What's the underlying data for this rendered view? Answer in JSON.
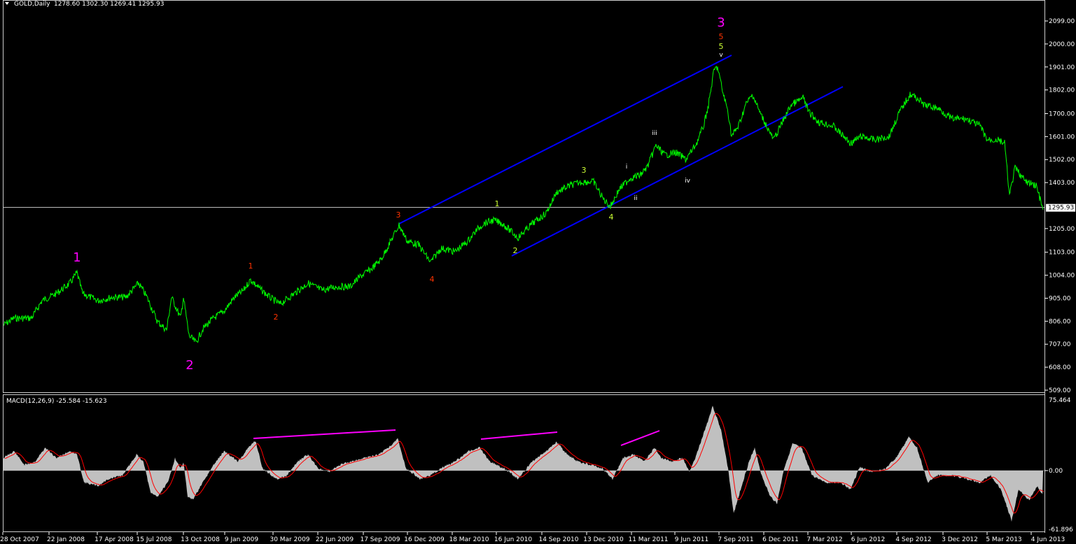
{
  "header": {
    "symbol": "GOLD,Daily",
    "ohlc": "1278.60 1302.30 1269.41 1295.93",
    "dropdown_icon": "triangle-down-icon"
  },
  "macd": {
    "label": "MACD(12,26,9) -25.584 -15.623",
    "max_label": "75.464",
    "zero_label": "0.00",
    "min_label": "-61.896"
  },
  "colors": {
    "background": "#000000",
    "price": "#00ff00",
    "channel": "#0000ff",
    "hist": "#c0c0c0",
    "signal": "#ff0000",
    "divergence": "#ff00ff",
    "cycle_wave": "#ff00ff",
    "primary_wave": "#ff3300",
    "intermediate_wave": "#ccff33",
    "minor_wave": "#ffffff",
    "axis_text": "#ffffff",
    "frame": "#cccccc"
  },
  "current_price_label": "1295.93",
  "chart_data": {
    "type": "line",
    "title": "",
    "price_axis": {
      "ticks": [
        "2099.00",
        "2000.00",
        "1901.00",
        "1802.00",
        "1700.00",
        "1601.00",
        "1502.00",
        "1403.00",
        "1205.00",
        "1103.00",
        "1004.00",
        "905.00",
        "806.00",
        "707.00",
        "608.00",
        "509.00"
      ],
      "ylim": [
        509,
        2099
      ],
      "current_price": 1295.93
    },
    "x_axis": {
      "tick_labels": [
        "28 Oct 2007",
        "22 Jan 2008",
        "17 Apr 2008",
        "15 Jul 2008",
        "13 Oct 2008",
        "9 Jan 2009",
        "30 Mar 2009",
        "22 Jun 2009",
        "17 Sep 2009",
        "16 Dec 2009",
        "18 Mar 2010",
        "16 Jun 2010",
        "14 Sep 2010",
        "13 Dec 2010",
        "11 Mar 2011",
        "9 Jun 2011",
        "7 Sep 2011",
        "6 Dec 2011",
        "7 Mar 2012",
        "6 Jun 2012",
        "4 Sep 2012",
        "3 Dec 2012",
        "5 Mar 2013",
        "4 Jun 2013"
      ]
    },
    "series": [
      {
        "x": [
          "28 Oct 2007",
          "22 Jan 2008",
          "17 Apr 2008",
          "15 Jul 2008",
          "13 Oct 2008",
          "9 Jan 2009",
          "30 Mar 2009",
          "22 Jun 2009",
          "17 Sep 2009",
          "16 Dec 2009",
          "18 Mar 2010",
          "16 Jun 2010",
          "14 Sep 2010",
          "13 Dec 2010",
          "11 Mar 2011",
          "9 Jun 2011",
          "7 Sep 2011",
          "6 Dec 2011",
          "7 Mar 2012",
          "6 Jun 2012",
          "4 Sep 2012",
          "3 Dec 2012",
          "5 Mar 2013",
          "4 Jun 2013"
        ],
        "values": [
          800,
          900,
          920,
          960,
          720,
          830,
          910,
          930,
          1020,
          1140,
          1110,
          1210,
          1260,
          1390,
          1410,
          1540,
          1870,
          1640,
          1690,
          1590,
          1720,
          1720,
          1590,
          1310
        ]
      }
    ],
    "macd_panel": {
      "ylim": [
        -61.896,
        75.464
      ],
      "macd_line_last": -25.584,
      "signal_last": -15.623
    },
    "annotations": [
      {
        "text": "1",
        "date": "22 Jan 2008",
        "price": 1100,
        "level": "cycle"
      },
      {
        "text": "2",
        "date": "13 Oct 2008",
        "price": 610,
        "level": "cycle"
      },
      {
        "text": "3",
        "date": "7 Sep 2011",
        "price": 2120,
        "level": "cycle"
      },
      {
        "text": "1",
        "date": "9 Jan 2009",
        "price": 1080,
        "level": "primary"
      },
      {
        "text": "2",
        "date": "30 Mar 2009",
        "price": 860,
        "level": "primary"
      },
      {
        "text": "3",
        "date": "17 Sep 2009",
        "price": 1300,
        "level": "primary"
      },
      {
        "text": "4",
        "date": "16 Dec 2009",
        "price": 1040,
        "level": "primary"
      },
      {
        "text": "5",
        "date": "7 Sep 2011",
        "price": 2055,
        "level": "primary"
      },
      {
        "text": "1",
        "date": "16 Jun 2010",
        "price": 1310,
        "level": "intermediate"
      },
      {
        "text": "2",
        "date": "16 Jun 2010",
        "price": 1105,
        "level": "intermediate"
      },
      {
        "text": "3",
        "date": "14 Sep 2010",
        "price": 1465,
        "level": "intermediate"
      },
      {
        "text": "4",
        "date": "13 Dec 2010",
        "price": 1275,
        "level": "intermediate"
      },
      {
        "text": "5",
        "date": "7 Sep 2011",
        "price": 2015,
        "level": "intermediate"
      },
      {
        "text": "i",
        "date": "11 Mar 2011",
        "price": 1480,
        "level": "minor"
      },
      {
        "text": "ii",
        "date": "11 Mar 2011",
        "price": 1345,
        "level": "minor"
      },
      {
        "text": "iii",
        "date": "11 Mar 2011",
        "price": 1620,
        "level": "minor"
      },
      {
        "text": "iv",
        "date": "9 Jun 2011",
        "price": 1410,
        "level": "minor"
      },
      {
        "text": "v",
        "date": "7 Sep 2011",
        "price": 1975,
        "level": "minor"
      }
    ],
    "trendlines": [
      {
        "name": "channel-upper",
        "from": {
          "date": "17 Sep 2009",
          "price": 1240
        },
        "to": {
          "date": "7 Sep 2011",
          "price": 1950
        }
      },
      {
        "name": "channel-lower",
        "from": {
          "date": "18 Mar 2010",
          "price": 1090
        },
        "to": {
          "date": "7 Mar 2012",
          "price": 1820
        }
      }
    ]
  }
}
